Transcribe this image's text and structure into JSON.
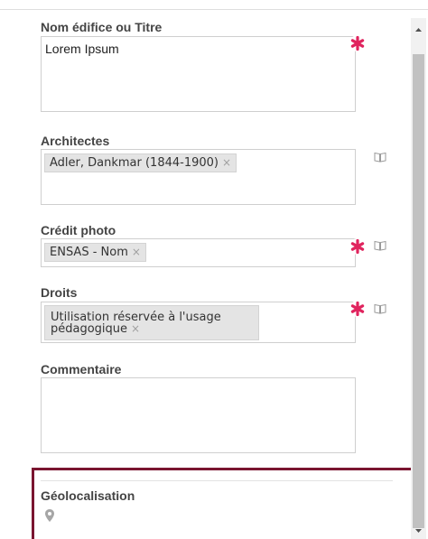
{
  "fields": {
    "title": {
      "label": "Nom édifice ou Titre",
      "value": "Lorem Ipsum",
      "required": true
    },
    "architects": {
      "label": "Architectes",
      "tags": [
        "Adler, Dankmar (1844-1900)"
      ],
      "remove_glyph": "×"
    },
    "photo_credit": {
      "label": "Crédit photo",
      "tags": [
        "ENSAS - Nom"
      ],
      "remove_glyph": "×",
      "required": true
    },
    "rights": {
      "label": "Droits",
      "tags": [
        "Utilisation réservée à l'usage pédagogique"
      ],
      "remove_glyph": "×",
      "required": true
    },
    "comment": {
      "label": "Commentaire",
      "value": ""
    },
    "geolocation": {
      "label": "Géolocalisation",
      "icon": "map-pin-icon"
    }
  },
  "icons": {
    "required": "asterisk-icon",
    "thesaurus": "book-icon"
  },
  "colors": {
    "required": "#e0245e",
    "highlight_frame": "#7a1530",
    "tag_bg": "#e4e4e4",
    "label": "#444444"
  }
}
